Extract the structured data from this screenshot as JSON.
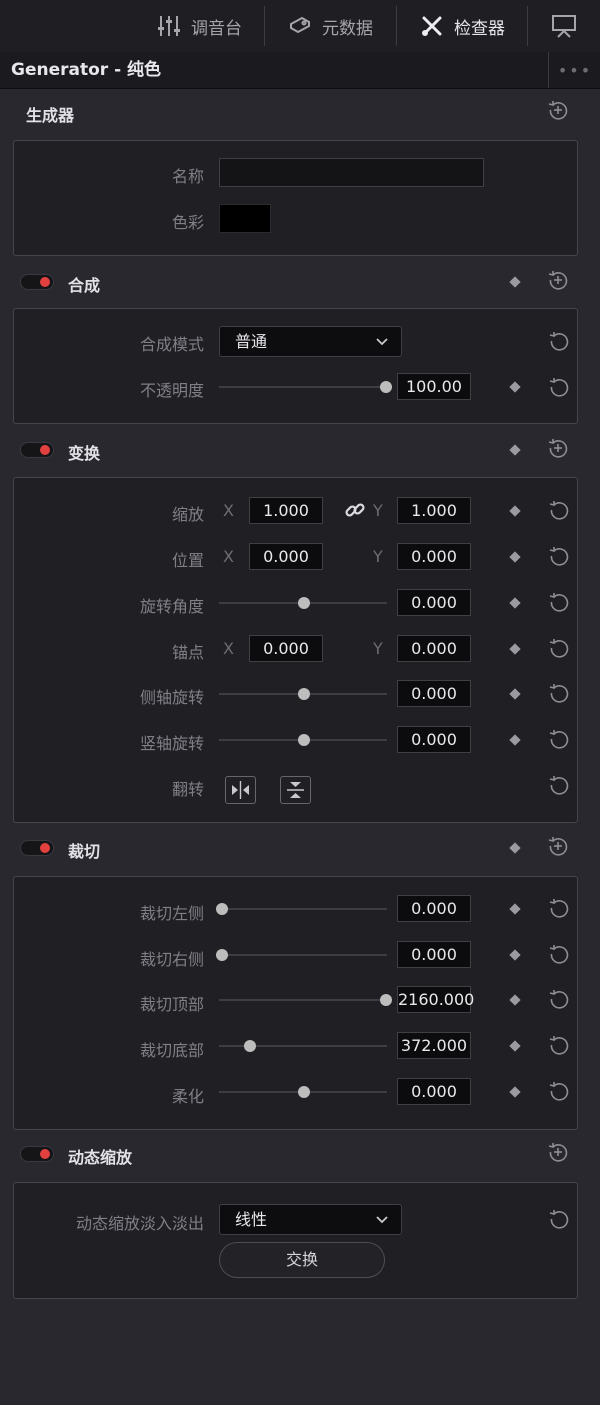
{
  "tabs": [
    {
      "label": "调音台",
      "icon": "mixer-icon"
    },
    {
      "label": "元数据",
      "icon": "metadata-tag-icon"
    },
    {
      "label": "检查器",
      "icon": "inspector-tools-icon"
    },
    {
      "label": "",
      "icon": "display-output-icon"
    }
  ],
  "title": "Generator - 纯色",
  "title_more": "•••",
  "generator": {
    "header": "生成器",
    "name_label": "名称",
    "name_value": "",
    "color_label": "色彩",
    "color_value": "#000000"
  },
  "composite": {
    "header": "合成",
    "mode_label": "合成模式",
    "mode_value": "普通",
    "opacity_label": "不透明度",
    "opacity_value": "100.00",
    "opacity_pos": 1.0
  },
  "transform": {
    "header": "变换",
    "zoom_label": "缩放",
    "zoom_x": "1.000",
    "zoom_y": "1.000",
    "position_label": "位置",
    "position_x": "0.000",
    "position_y": "0.000",
    "rotation_label": "旋转角度",
    "rotation_value": "0.000",
    "anchor_label": "锚点",
    "anchor_x": "0.000",
    "anchor_y": "0.000",
    "pitch_label": "侧轴旋转",
    "pitch_value": "0.000",
    "yaw_label": "竖轴旋转",
    "yaw_value": "0.000",
    "flip_label": "翻转",
    "x_axis": "X",
    "y_axis": "Y"
  },
  "crop": {
    "header": "裁切",
    "left_label": "裁切左侧",
    "left_value": "0.000",
    "right_label": "裁切右侧",
    "right_value": "0.000",
    "top_label": "裁切顶部",
    "top_value": "2160.000",
    "bottom_label": "裁切底部",
    "bottom_value": "372.000",
    "soft_label": "柔化",
    "soft_value": "0.000"
  },
  "dynamic_zoom": {
    "header": "动态缩放",
    "ease_label": "动态缩放淡入淡出",
    "ease_value": "线性",
    "swap_label": "交换"
  },
  "colors": {
    "toggle_on": "#e34040",
    "background": "#28282e",
    "panel": "#1f1f24"
  }
}
